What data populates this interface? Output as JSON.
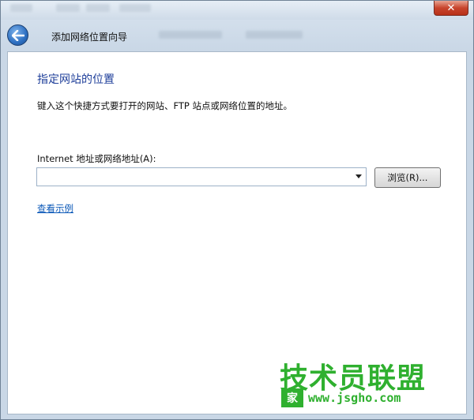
{
  "window": {
    "close_label": "✕",
    "wizard_title": "添加网络位置向导"
  },
  "page": {
    "heading": "指定网站的位置",
    "description": "键入这个快捷方式要打开的网站、FTP 站点或网络位置的地址。",
    "address_label": "Internet 地址或网络地址(A):",
    "address_value": "",
    "browse_label": "浏览(R)...",
    "example_link": "查看示例"
  },
  "watermark": {
    "main_text": "技术员联盟",
    "badge": "家",
    "url": "www.jsgho.com"
  },
  "colors": {
    "heading": "#1f3f9a",
    "link": "#0b58b8",
    "close": "#c8452d",
    "watermark": "#2fb02f"
  },
  "icons": {
    "back": "back-arrow-icon",
    "dropdown": "chevron-down-icon"
  }
}
